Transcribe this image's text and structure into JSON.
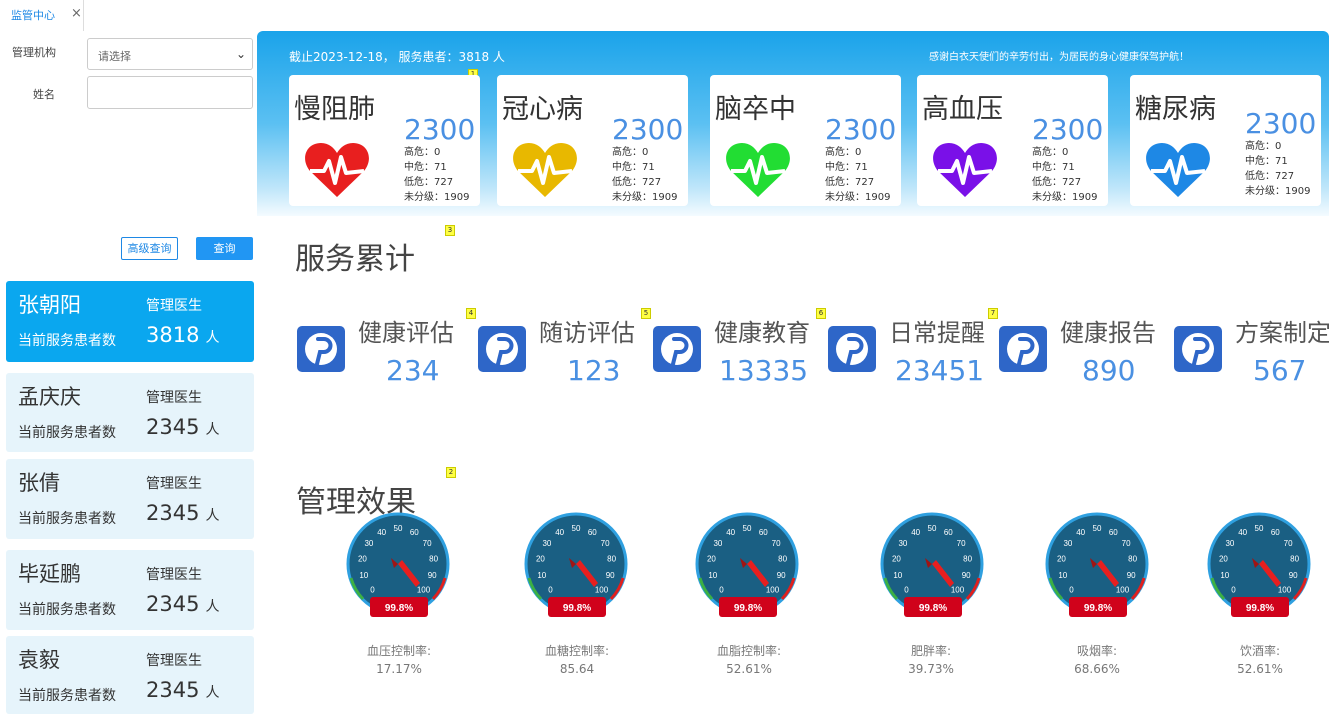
{
  "tabbar": {
    "tab_label": "监管中心",
    "close": "×"
  },
  "filter": {
    "org_label": "管理机构",
    "org_value": "请选择",
    "name_label": "姓名",
    "name_value": "",
    "adv_button": "高级查询",
    "query_button": "查询"
  },
  "doctors": [
    {
      "name": "张朝阳",
      "role": "管理医生",
      "count_label": "当前服务患者数",
      "count": "3818",
      "unit": "人"
    },
    {
      "name": "孟庆庆",
      "role": "管理医生",
      "count_label": "当前服务患者数",
      "count": "2345",
      "unit": "人"
    },
    {
      "name": "张倩",
      "role": "管理医生",
      "count_label": "当前服务患者数",
      "count": "2345",
      "unit": "人"
    },
    {
      "name": "毕延鹏",
      "role": "管理医生",
      "count_label": "当前服务患者数",
      "count": "2345",
      "unit": "人"
    },
    {
      "name": "袁毅",
      "role": "管理医生",
      "count_label": "当前服务患者数",
      "count": "2345",
      "unit": "人"
    }
  ],
  "banner": {
    "info": "截止2023-12-18， 服务患者：3818 人",
    "thanks": "感谢白衣天使们的辛劳付出，为居民的身心健康保驾护航！",
    "badge": "1"
  },
  "diseases": [
    {
      "name": "慢阻肺",
      "total": "2300",
      "high": "高危：0",
      "mid": "中危：71",
      "low": "低危：727",
      "none": "未分级：1909",
      "color": "#e81f1f"
    },
    {
      "name": "冠心病",
      "total": "2300",
      "high": "高危：0",
      "mid": "中危：71",
      "low": "低危：727",
      "none": "未分级：1909",
      "color": "#e8b800"
    },
    {
      "name": "脑卒中",
      "total": "2300",
      "high": "高危：0",
      "mid": "中危：71",
      "low": "低危：727",
      "none": "未分级：1909",
      "color": "#22dd33"
    },
    {
      "name": "高血压",
      "total": "2300",
      "high": "高危：0",
      "mid": "中危：71",
      "low": "低危：727",
      "none": "未分级：1909",
      "color": "#7a10e8"
    },
    {
      "name": "糖尿病",
      "total": "2300",
      "high": "高危：0",
      "mid": "中危：71",
      "low": "低危：727",
      "none": "未分级：1909",
      "color": "#1e88e5"
    }
  ],
  "services": {
    "title": "服务累计",
    "badge": "3",
    "items": [
      {
        "label": "健康评估",
        "value": "234",
        "badge": "4",
        "icon": "pinterest-icon"
      },
      {
        "label": "随访评估",
        "value": "123",
        "badge": "5",
        "icon": "pinterest-icon"
      },
      {
        "label": "健康教育",
        "value": "13335",
        "badge": "6",
        "icon": "pinterest-icon"
      },
      {
        "label": "日常提醒",
        "value": "23451",
        "badge": "7",
        "icon": "pinterest-icon"
      },
      {
        "label": "健康报告",
        "value": "890",
        "badge": "",
        "icon": "pinterest-icon"
      },
      {
        "label": "方案制定",
        "value": "567",
        "badge": "",
        "icon": "pinterest-icon"
      }
    ]
  },
  "effects": {
    "title": "管理效果",
    "badge": "2",
    "gauge_readout": "99.8%",
    "gauge_ticks": [
      "0",
      "10",
      "20",
      "30",
      "40",
      "50",
      "60",
      "70",
      "80",
      "90",
      "100"
    ],
    "items": [
      {
        "label": "血压控制率:",
        "value": "17.17%"
      },
      {
        "label": "血糖控制率:",
        "value": "85.64"
      },
      {
        "label": "血脂控制率:",
        "value": "52.61%"
      },
      {
        "label": "肥胖率:",
        "value": "39.73%"
      },
      {
        "label": "吸烟率:",
        "value": "68.66%"
      },
      {
        "label": "饮酒率:",
        "value": "52.61%"
      }
    ]
  }
}
